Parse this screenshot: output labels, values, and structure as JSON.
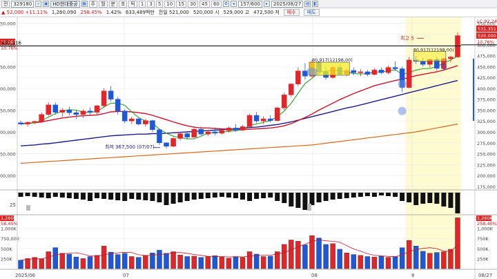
{
  "toolbar": {
    "view_label": "전",
    "code": "329180",
    "stock_name": "HD현대중공",
    "period_buttons": [
      "주",
      "월",
      "분",
      "초",
      "틱"
    ],
    "interval_buttons": [
      "1",
      "3",
      "5",
      "10",
      "15",
      "30",
      "45",
      "60"
    ],
    "bar_count": "157/600",
    "date": "2025/08/27"
  },
  "quote": {
    "arrow": "▲",
    "change": "52,000",
    "change_pct": "+11.11%",
    "volume": "1,260,090",
    "vol_ratio": "258.45%",
    "turnover": "1.42%",
    "amount": "633,489백만",
    "prev_label": "전일",
    "prev_value": "521,000",
    "open_label": "시",
    "open_value": "520,000",
    "high_label": "고",
    "high_value": "529,000",
    "low_label": "저",
    "low_value": "472,500",
    "buy_label": "매수",
    "sell_label": "매도"
  },
  "price_axis": {
    "ticks": [
      "550,000",
      "525,000",
      "500,000",
      "475,000",
      "450,000",
      "425,000",
      "400,000",
      "375,000",
      "350,000",
      "325,000",
      "300,000",
      "275,000",
      "250,000",
      "225,000",
      "200,000",
      "175,000"
    ],
    "left_ticks": [
      "50,000",
      "",
      "00,000",
      "",
      "50,000",
      "",
      "00,000",
      "",
      "50,000",
      "",
      "00,000",
      "",
      "50,000",
      "",
      "00,000"
    ],
    "lc_label": "LC:92.24",
    "badge_price": "531,351",
    "badge_close": "520,000",
    "badge_pct": "10.76%",
    "left_badge_price": "20,000",
    "left_badge_pct": "10.76%"
  },
  "annotations": {
    "hline_label": "497,316",
    "high_marker": "최고 5",
    "low_marker": "최저 367,500 (07/07)",
    "box_label_1": "80,917(12198,00)",
    "box_label_2": "80,917(12198,00)"
  },
  "osc_axis": {
    "tick": "25"
  },
  "volume_axis": {
    "badge": "1,260K",
    "pct": "258.45%",
    "ticks": [
      "1,000K",
      "750K",
      "500K",
      "250K"
    ],
    "left_badge": "1,260K",
    "left_pct": "58.45%",
    "left_ticks": [
      "1,000K",
      "750,000",
      "500K",
      "250K"
    ]
  },
  "date_axis": {
    "labels": [
      "2025/06",
      "07",
      "08",
      "8",
      "08/27"
    ]
  },
  "colors": {
    "up": "#e0262b",
    "down": "#1e58d8",
    "ma5": "#2aa02a",
    "ma20": "#c8142d",
    "ma60": "#1b1b8f",
    "ma120": "#d2691e",
    "highlight": "#fffbd0"
  },
  "chart_data": {
    "type": "candlestick",
    "title": "",
    "series": [
      {
        "name": "",
        "values": [
          [
            321,
            326,
            316,
            318
          ],
          [
            318,
            324,
            312,
            322
          ],
          [
            322,
            326,
            318,
            324
          ],
          [
            324,
            345,
            320,
            340
          ],
          [
            340,
            368,
            336,
            362
          ],
          [
            362,
            368,
            340,
            345
          ],
          [
            345,
            355,
            335,
            350
          ],
          [
            350,
            358,
            338,
            344
          ],
          [
            344,
            350,
            330,
            340
          ],
          [
            340,
            352,
            332,
            348
          ],
          [
            348,
            356,
            340,
            345
          ],
          [
            345,
            362,
            340,
            360
          ],
          [
            360,
            400,
            355,
            394
          ],
          [
            394,
            405,
            370,
            375
          ],
          [
            375,
            380,
            340,
            348
          ],
          [
            348,
            352,
            320,
            325
          ],
          [
            325,
            335,
            318,
            330
          ],
          [
            330,
            332,
            315,
            318
          ],
          [
            318,
            330,
            312,
            326
          ],
          [
            326,
            328,
            300,
            305
          ],
          [
            305,
            308,
            270,
            275
          ],
          [
            275,
            276,
            262,
            267
          ],
          [
            267,
            288,
            265,
            285
          ],
          [
            285,
            300,
            280,
            296
          ],
          [
            296,
            300,
            283,
            288
          ],
          [
            288,
            310,
            286,
            306
          ],
          [
            306,
            312,
            292,
            295
          ],
          [
            295,
            305,
            290,
            300
          ],
          [
            300,
            310,
            292,
            297
          ],
          [
            297,
            306,
            294,
            303
          ],
          [
            303,
            312,
            298,
            309
          ],
          [
            309,
            318,
            300,
            304
          ],
          [
            304,
            316,
            302,
            312
          ],
          [
            312,
            342,
            308,
            338
          ],
          [
            338,
            346,
            320,
            325
          ],
          [
            325,
            336,
            318,
            330
          ],
          [
            330,
            338,
            322,
            326
          ],
          [
            326,
            358,
            324,
            355
          ],
          [
            355,
            390,
            350,
            385
          ],
          [
            385,
            412,
            380,
            410
          ],
          [
            410,
            448,
            405,
            440
          ],
          [
            440,
            458,
            420,
            428
          ],
          [
            428,
            465,
            425,
            460
          ],
          [
            460,
            462,
            432,
            438
          ],
          [
            438,
            450,
            420,
            425
          ],
          [
            425,
            452,
            422,
            448
          ],
          [
            448,
            455,
            430,
            432
          ],
          [
            432,
            446,
            428,
            441
          ],
          [
            441,
            448,
            430,
            436
          ],
          [
            436,
            444,
            428,
            438
          ],
          [
            438,
            442,
            428,
            432
          ],
          [
            432,
            446,
            430,
            442
          ],
          [
            442,
            448,
            432,
            436
          ],
          [
            436,
            452,
            432,
            448
          ],
          [
            448,
            462,
            440,
            445
          ],
          [
            445,
            450,
            392,
            402
          ],
          [
            402,
            472,
            400,
            465
          ],
          [
            465,
            474,
            456,
            462
          ],
          [
            462,
            470,
            450,
            455
          ],
          [
            455,
            468,
            448,
            466
          ],
          [
            466,
            472,
            440,
            446
          ],
          [
            446,
            470,
            442,
            468
          ],
          [
            468,
            475,
            460,
            472
          ],
          [
            472,
            529,
            470,
            521
          ]
        ]
      }
    ],
    "ma5": [
      320,
      320,
      321,
      326,
      334,
      342,
      348,
      351,
      350,
      345,
      345,
      347,
      357,
      366,
      366,
      361,
      346,
      333,
      325,
      320,
      306,
      297,
      290,
      287,
      284,
      284,
      290,
      297,
      299,
      300,
      301,
      303,
      305,
      315,
      318,
      322,
      326,
      335,
      348,
      366,
      389,
      411,
      423,
      436,
      440,
      441,
      440,
      437,
      434,
      433,
      434,
      437,
      438,
      440,
      443,
      432,
      436,
      442,
      445,
      446,
      450,
      458,
      465,
      474
    ],
    "ma20": [
      318,
      320,
      321,
      323,
      326,
      329,
      332,
      334,
      336,
      337,
      338,
      339,
      342,
      346,
      347,
      347,
      346,
      344,
      342,
      338,
      333,
      328,
      323,
      318,
      314,
      311,
      309,
      309,
      308,
      307,
      306,
      305,
      305,
      306,
      307,
      308,
      309,
      311,
      314,
      319,
      326,
      333,
      341,
      350,
      358,
      366,
      374,
      381,
      388,
      394,
      400,
      406,
      410,
      414,
      418,
      421,
      425,
      429,
      432,
      435,
      438,
      442,
      447,
      452
    ],
    "ma60": [
      268,
      269,
      270,
      272,
      273,
      275,
      277,
      279,
      281,
      283,
      285,
      287,
      289,
      291,
      292,
      293,
      294,
      295,
      295,
      296,
      296,
      297,
      298,
      299,
      300,
      301,
      302,
      303,
      304,
      305,
      306,
      307,
      308,
      310,
      311,
      313,
      315,
      317,
      320,
      323,
      327,
      331,
      335,
      339,
      343,
      347,
      351,
      355,
      358,
      362,
      366,
      370,
      374,
      378,
      382,
      386,
      390,
      394,
      398,
      402,
      406,
      410,
      414,
      418
    ],
    "ma120": [
      228,
      229,
      230,
      231,
      232,
      233,
      234,
      235,
      236,
      237,
      238,
      239,
      240,
      241,
      242,
      243,
      244,
      245,
      246,
      247,
      248,
      249,
      250,
      251,
      252,
      253,
      254,
      255,
      256,
      257,
      258,
      259,
      260,
      261,
      262,
      263,
      264,
      265,
      266,
      267,
      268,
      269,
      270,
      272,
      274,
      276,
      278,
      280,
      282,
      284,
      286,
      288,
      290,
      292,
      294,
      296,
      298,
      300,
      303,
      306,
      309,
      312,
      315,
      318
    ],
    "volume": [
      210,
      250,
      280,
      240,
      420,
      520,
      380,
      360,
      290,
      250,
      300,
      330,
      560,
      410,
      350,
      380,
      300,
      280,
      320,
      390,
      460,
      380,
      420,
      340,
      300,
      310,
      280,
      300,
      320,
      290,
      260,
      300,
      280,
      420,
      360,
      300,
      310,
      420,
      600,
      710,
      680,
      590,
      820,
      760,
      600,
      620,
      480,
      390,
      350,
      330,
      300,
      290,
      310,
      280,
      300,
      520,
      700,
      560,
      430,
      380,
      400,
      420,
      480,
      1260
    ],
    "osc": [
      -6,
      -5,
      -6,
      -7,
      -8,
      -6,
      -7,
      -8,
      -9,
      -10,
      -12,
      -8,
      -9,
      -10,
      -11,
      -12,
      -9,
      -10,
      -11,
      -12,
      -14,
      -18,
      -16,
      -14,
      -12,
      -10,
      -9,
      -8,
      -7,
      -6,
      -7,
      -8,
      -10,
      -12,
      -9,
      -8,
      -7,
      -12,
      -15,
      -20,
      -22,
      -25,
      -18,
      -14,
      -12,
      -10,
      -9,
      -8,
      -7,
      -6,
      -5,
      -6,
      -4,
      -5,
      -6,
      -12,
      -14,
      -18,
      -16,
      -15,
      -16,
      -20,
      -22,
      -30
    ],
    "ylim": [
      170,
      560
    ],
    "highlight_from_index": 56
  }
}
